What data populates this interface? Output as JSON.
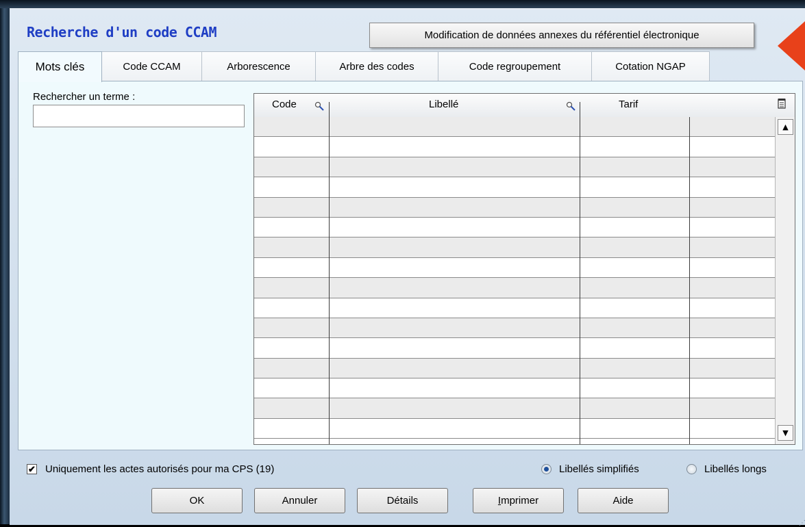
{
  "window": {
    "title": "Recherche d'un code CCAM",
    "modif_button": "Modification de données annexes du référentiel électronique"
  },
  "tabs": [
    {
      "label": "Mots clés",
      "active": true
    },
    {
      "label": "Code CCAM",
      "active": false
    },
    {
      "label": "Arborescence",
      "active": false
    },
    {
      "label": "Arbre des codes",
      "active": false
    },
    {
      "label": "Code regroupement",
      "active": false
    },
    {
      "label": "Cotation NGAP",
      "active": false
    }
  ],
  "search": {
    "label": "Rechercher un terme :",
    "value": "",
    "placeholder": ""
  },
  "grid": {
    "columns": [
      "Code",
      "Libellé",
      "Tarif",
      ""
    ],
    "rows": [],
    "search_icon": "magnifier-icon",
    "menu_icon": "grid-options-icon"
  },
  "options": {
    "checkbox_label": "Uniquement les actes autorisés pour ma CPS (19)",
    "checkbox_checked": true,
    "radio_simplified": "Libellés simplifiés",
    "radio_long": "Libellés longs",
    "radio_selected": "simplified"
  },
  "buttons": {
    "ok": "OK",
    "cancel": "Annuler",
    "details": "Détails",
    "print_first": "I",
    "print_rest": "mprimer",
    "help": "Aide"
  },
  "colors": {
    "title": "#1f3ec4",
    "panel": "#effafd",
    "accent_arrow": "#e8411a"
  }
}
